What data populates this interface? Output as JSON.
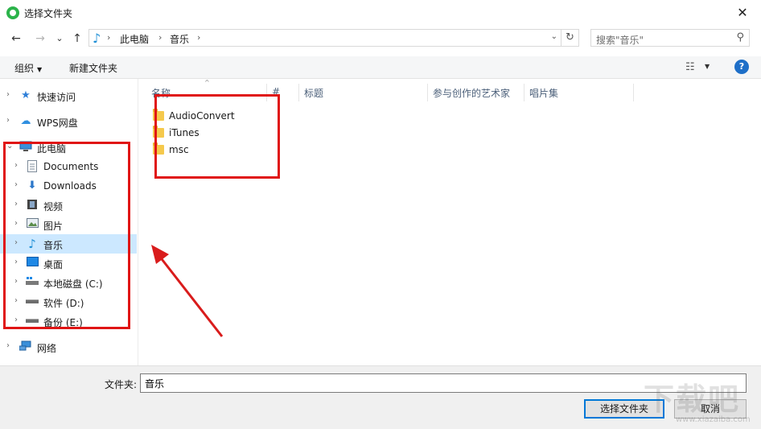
{
  "window": {
    "title": "选择文件夹",
    "close_glyph": "✕"
  },
  "address": {
    "back_glyph": "←",
    "forward_glyph": "→",
    "recent_glyph": "⌄",
    "up_glyph": "↑",
    "crumbs": [
      "此电脑",
      "音乐"
    ],
    "sep": "›",
    "dropdown_glyph": "⌄",
    "refresh_glyph": "↻"
  },
  "search": {
    "placeholder": "搜索\"音乐\"",
    "icon_glyph": "⚲"
  },
  "toolbar": {
    "organize": "组织",
    "organize_caret": "▼",
    "new_folder": "新建文件夹",
    "view_glyph": "☷",
    "view_caret": "▼",
    "help": "?"
  },
  "nav": {
    "quick_access": "快速访问",
    "wps": "WPS网盘",
    "this_pc": "此电脑",
    "documents": "Documents",
    "downloads": "Downloads",
    "videos": "视频",
    "pictures": "图片",
    "music": "音乐",
    "desktop": "桌面",
    "drive_c": "本地磁盘 (C:)",
    "drive_d": "软件 (D:)",
    "drive_e": "备份 (E:)",
    "network": "网络",
    "collapsed_glyph": "›",
    "expanded_glyph": "⌄"
  },
  "columns": {
    "name": "名称",
    "number": "#",
    "title": "标题",
    "artists": "参与创作的艺术家",
    "album": "唱片集",
    "sort_glyph": "^"
  },
  "files": [
    "AudioConvert",
    "iTunes",
    "msc"
  ],
  "footer": {
    "folder_label": "文件夹:",
    "folder_value": "音乐",
    "select_button": "选择文件夹",
    "cancel_button": "取消"
  },
  "watermark": {
    "main": "下载吧",
    "sub": "www.xiazaiba.com"
  }
}
